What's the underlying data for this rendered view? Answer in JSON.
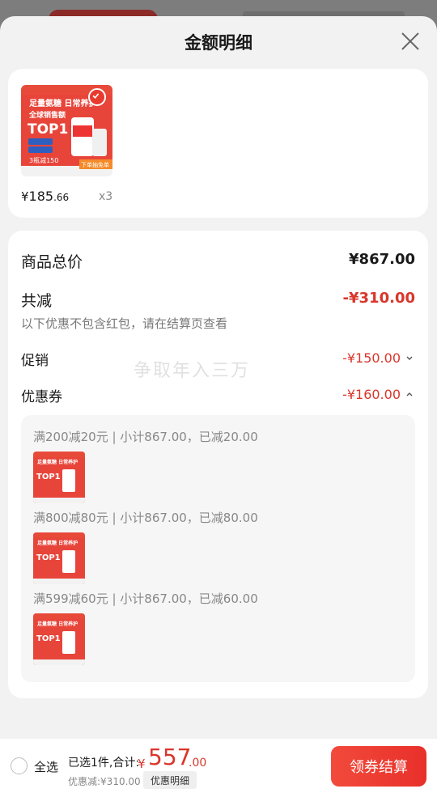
{
  "header": {
    "title": "金额明细"
  },
  "product": {
    "price_symbol": "¥",
    "price_int": "185",
    "price_dec": ".66",
    "quantity": "x3",
    "thumb": {
      "line1": "足量氨糖 日常养护",
      "line2": "全球销售额",
      "line3": "TOP1",
      "line4": "3瓶减150",
      "corner": "下单抽免单"
    }
  },
  "detail": {
    "total_label": "商品总价",
    "total_value": "¥867.00",
    "reduce_label": "共减",
    "reduce_value": "-¥310.00",
    "note": "以下优惠不包含红包，请在结算页查看",
    "promo_label": "促销",
    "promo_value": "-¥150.00",
    "coupon_label": "优惠券",
    "coupon_value": "-¥160.00",
    "watermark": "争取年入三万",
    "coupons": [
      {
        "text": "满200减20元 | 小计867.00，已减20.00"
      },
      {
        "text": "满800减80元 | 小计867.00，已减80.00"
      },
      {
        "text": "满599减60元 | 小计867.00，已减60.00"
      }
    ]
  },
  "footer": {
    "select_all": "全选",
    "summary": "已选1件,合计:",
    "total_symbol": "¥",
    "total_int": "557",
    "total_dec": ".00",
    "discount_note": "优惠减:¥310.00",
    "detail_chip": "优惠明细",
    "checkout": "领券结算"
  },
  "colors": {
    "accent": "#e8302a",
    "price_red": "#d9362b",
    "sheet_bg": "#f2f2f2"
  }
}
